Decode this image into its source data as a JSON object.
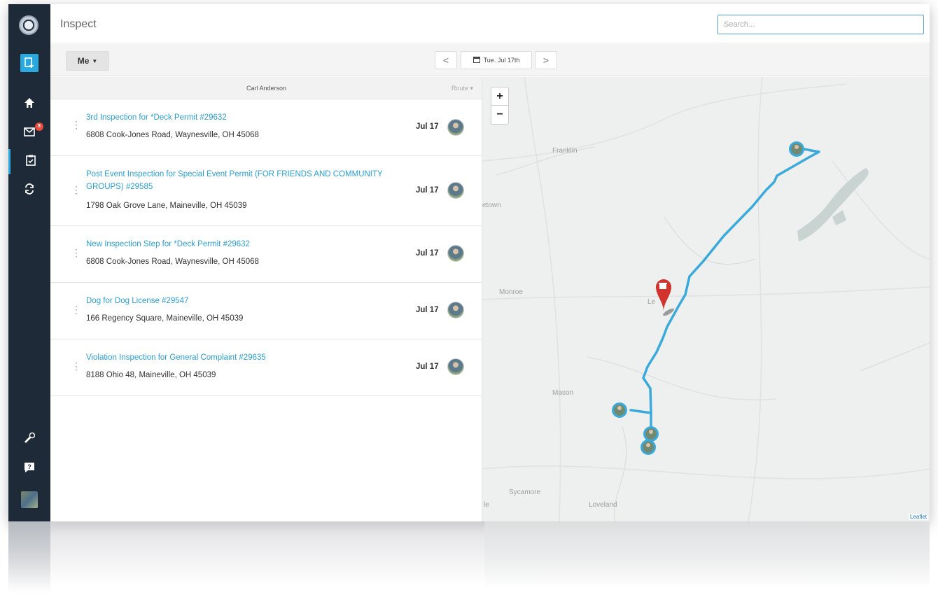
{
  "app": {
    "page_title": "Inspect",
    "search_placeholder": "Search..."
  },
  "sidebar": {
    "mail_badge": "8",
    "items": [
      {
        "name": "logo"
      },
      {
        "name": "new-record"
      },
      {
        "name": "home"
      },
      {
        "name": "inbox"
      },
      {
        "name": "inspect"
      },
      {
        "name": "sync"
      },
      {
        "name": "tools"
      },
      {
        "name": "help"
      },
      {
        "name": "profile"
      }
    ]
  },
  "toolbar": {
    "assignee_label": "Me",
    "prev_label": "<",
    "next_label": ">",
    "date_label": "Tue. Jul 17th"
  },
  "list": {
    "inspector_name": "Carl Anderson",
    "route_label": "Route",
    "rows": [
      {
        "title": "3rd Inspection for *Deck Permit #29632",
        "address": "6808 Cook-Jones Road, Waynesville, OH 45068",
        "date": "Jul 17"
      },
      {
        "title": "Post Event Inspection for Special Event Permit (FOR FRIENDS AND COMMUNITY GROUPS) #29585",
        "address": "1798 Oak Grove Lane, Maineville, OH 45039",
        "date": "Jul 17"
      },
      {
        "title": "New Inspection Step for *Deck Permit #29632",
        "address": "6808 Cook-Jones Road, Waynesville, OH 45068",
        "date": "Jul 17"
      },
      {
        "title": "Dog for Dog License #29547",
        "address": "166 Regency Square, Maineville, OH 45039",
        "date": "Jul 17"
      },
      {
        "title": "Violation Inspection for General Complaint #29635",
        "address": "8188 Ohio 48, Maineville, OH 45039",
        "date": "Jul 17"
      }
    ]
  },
  "map": {
    "zoom_in": "+",
    "zoom_out": "−",
    "labels": [
      "Franklin",
      "etown",
      "Monroe",
      "Le",
      "Mason",
      "Sycamore",
      "Loveland",
      "le"
    ],
    "attribution": "Leaflet",
    "route_color": "#3aaadc",
    "pin_color": "#d0342c"
  }
}
